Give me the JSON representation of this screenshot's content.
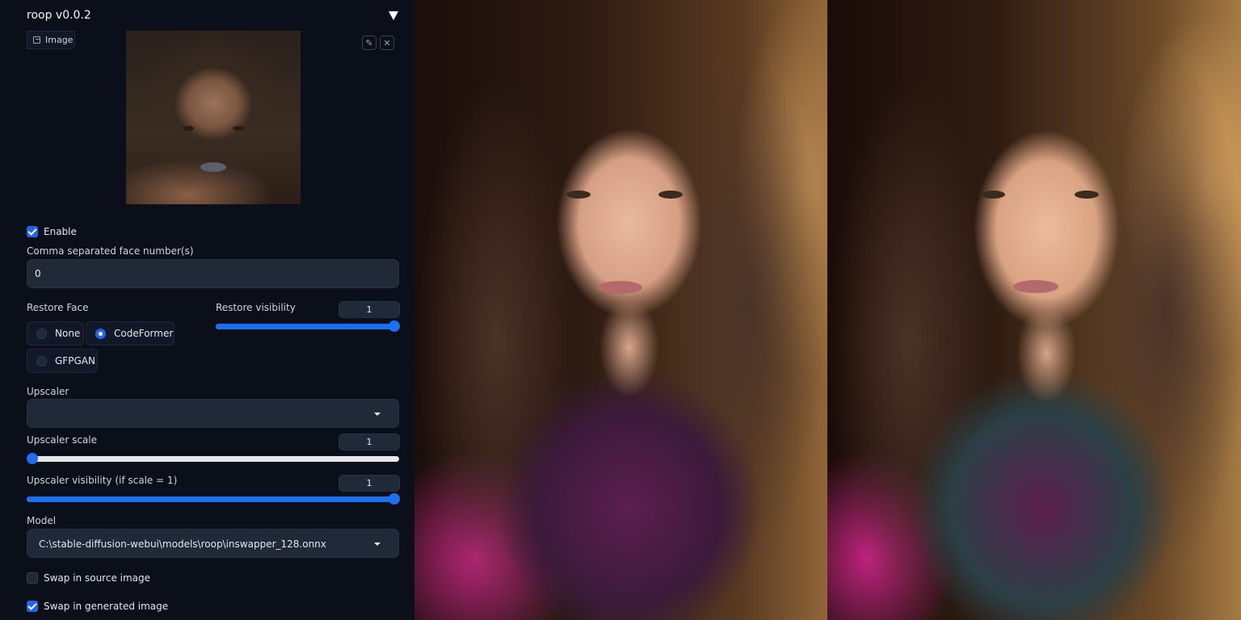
{
  "panel": {
    "title": "roop v0.0.2",
    "collapse_icon": "triangle-down-icon"
  },
  "source_image": {
    "tab_label": "Image",
    "tab_icon": "image-icon",
    "alt": "Source face image",
    "edit_icon": "pencil-icon",
    "clear_icon": "close-icon",
    "edit_glyph": "✎",
    "clear_glyph": "✕"
  },
  "enable": {
    "label": "Enable",
    "checked": true
  },
  "face_numbers": {
    "label": "Comma separated face number(s)",
    "value": "0"
  },
  "restore_face": {
    "label": "Restore Face",
    "options": [
      "None",
      "CodeFormer",
      "GFPGAN"
    ],
    "selected": "CodeFormer"
  },
  "restore_visibility": {
    "label": "Restore visibility",
    "value": "1",
    "fraction": 1.0
  },
  "upscaler": {
    "label": "Upscaler",
    "value": ""
  },
  "upscaler_scale": {
    "label": "Upscaler scale",
    "value": "1",
    "fraction": 0.0
  },
  "upscaler_visibility": {
    "label": "Upscaler visibility (if scale = 1)",
    "value": "1",
    "fraction": 1.0
  },
  "model": {
    "label": "Model",
    "value": "C:\\stable-diffusion-webui\\models\\roop\\inswapper_128.onnx"
  },
  "swap_source": {
    "label": "Swap in source image",
    "checked": false
  },
  "swap_generated": {
    "label": "Swap in generated image",
    "checked": true
  },
  "photos": [
    {
      "alt": "Original generated portrait"
    },
    {
      "alt": "Face-swapped portrait"
    }
  ],
  "colors": {
    "accent": "#2563eb",
    "slider": "#1d6ff2",
    "panel_bg": "#0b0f19",
    "input_bg": "#1f2937"
  }
}
